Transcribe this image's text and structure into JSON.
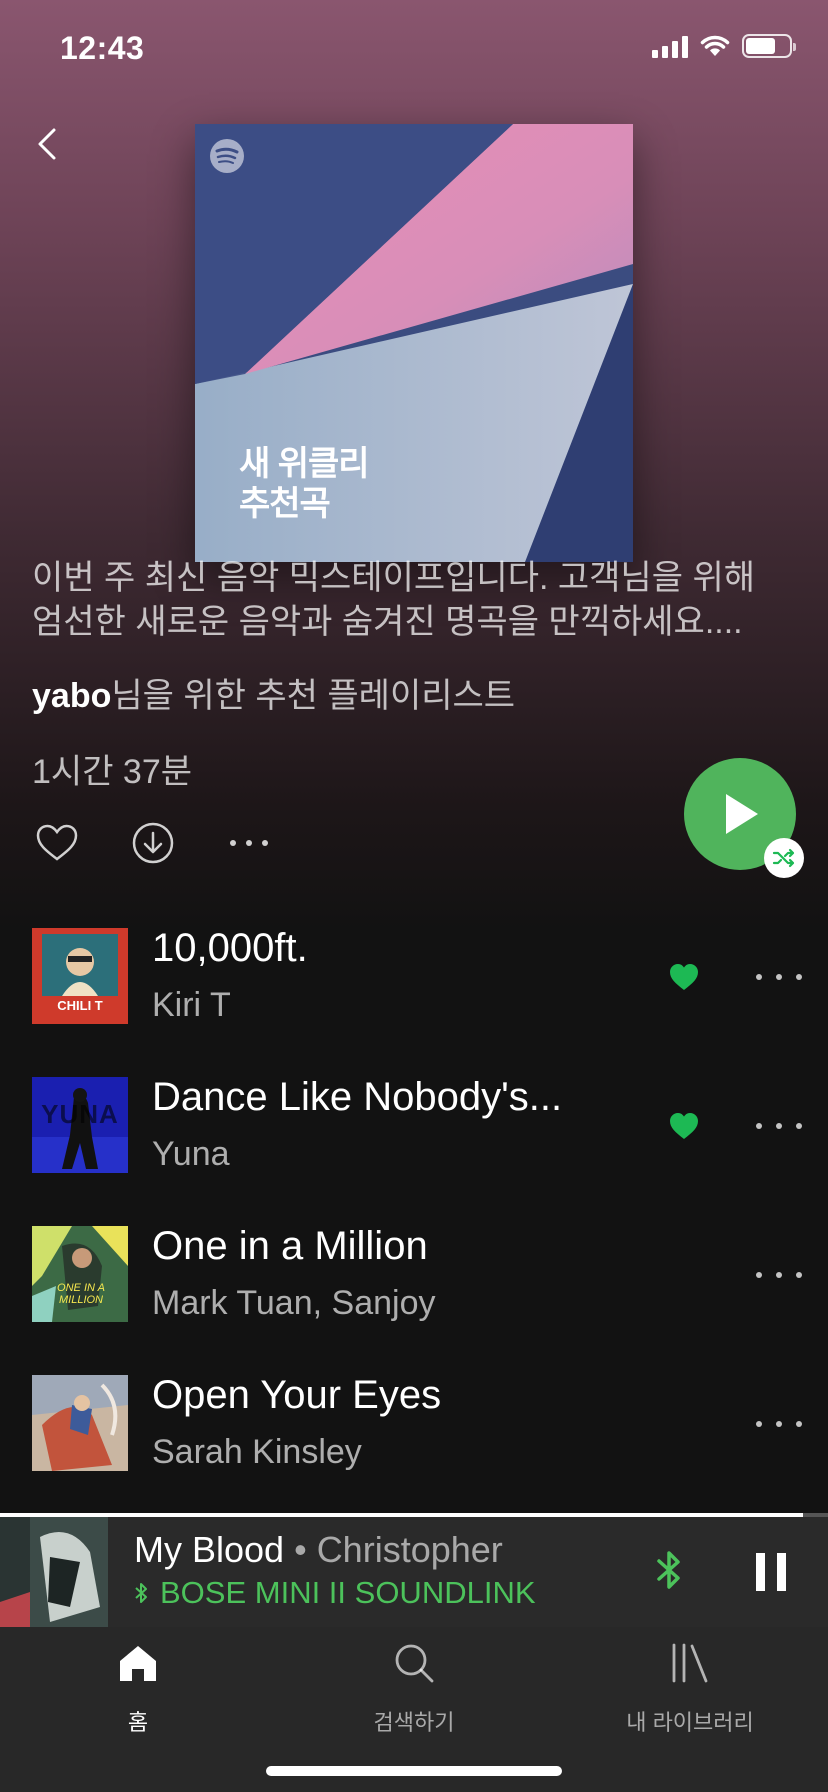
{
  "status_bar": {
    "time": "12:43"
  },
  "playlist": {
    "cover_title": "새 위클리\n추천곡",
    "description_line1": "이번 주 최신 음악 믹스테이프입니다. 고객님을 위해",
    "description_line2": "엄선한 새로운 음악과 숨겨진 명곡을 만끽하세요....",
    "owner_name": "yabo",
    "owner_suffix": "님을 위한 추천 플레이리스트",
    "duration": "1시간 37분"
  },
  "tracks": [
    {
      "title": "10,000ft.",
      "artist": "Kiri T",
      "liked": true,
      "art_text": "CHILI T"
    },
    {
      "title": "Dance Like Nobody's...",
      "artist": "Yuna",
      "liked": true,
      "art_text": "YUNA"
    },
    {
      "title": "One in a Million",
      "artist": "Mark Tuan, Sanjoy",
      "liked": false,
      "art_text": "ONE IN A MILLION"
    },
    {
      "title": "Open Your Eyes",
      "artist": "Sarah Kinsley",
      "liked": false,
      "art_text": ""
    }
  ],
  "now_playing": {
    "title": "My Blood",
    "separator": " • ",
    "artist": "Christopher",
    "device": "BOSE MINI II SOUNDLINK",
    "progress": 0.97
  },
  "tabs": [
    {
      "label": "홈",
      "icon": "home-icon",
      "active": true
    },
    {
      "label": "검색하기",
      "icon": "search-icon",
      "active": false
    },
    {
      "label": "내 라이브러리",
      "icon": "library-icon",
      "active": false
    }
  ],
  "colors": {
    "accent_green": "#1db954",
    "play_green": "#50b45c",
    "device_green": "#4cc25b"
  }
}
